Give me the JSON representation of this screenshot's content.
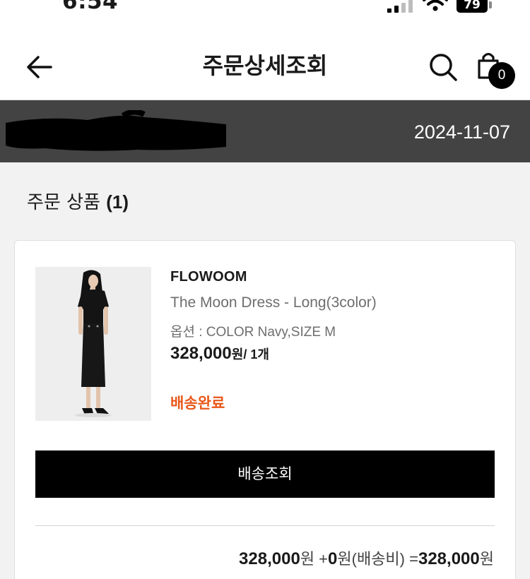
{
  "status_bar": {
    "time": "6:54",
    "battery": "79"
  },
  "header": {
    "title": "주문상세조회",
    "cart_count": "0"
  },
  "order": {
    "date": "2024-11-07"
  },
  "section": {
    "title": "주문 상품",
    "count": "(1)"
  },
  "product": {
    "brand": "FLOWOOM",
    "name": "The Moon Dress - Long(3color)",
    "option": "옵션 : COLOR Navy,SIZE M",
    "price": "328,000",
    "price_unit": "원/ 1개",
    "status": "배송완료",
    "status_color": "#e8581a"
  },
  "actions": {
    "track_label": "배송조회"
  },
  "summary": {
    "item_total": "328,000",
    "item_unit": "원",
    "plus_sign": " +",
    "shipping": "0",
    "shipping_label": "원(배송비)",
    "equals": " =",
    "grand_total": "328,000",
    "grand_unit": "원"
  },
  "colors": {
    "order_bar": "#434343",
    "accent": "#e8581a",
    "button": "#000000"
  }
}
